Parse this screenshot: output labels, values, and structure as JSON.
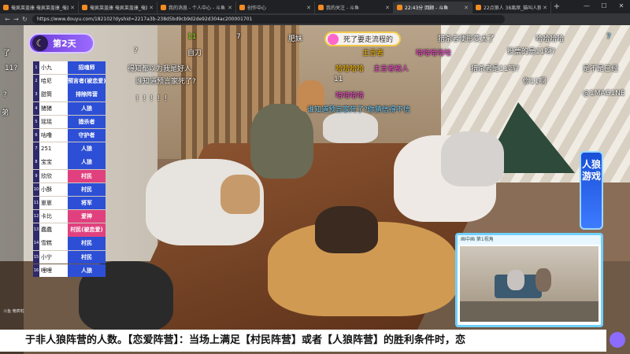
{
  "tabs": [
    {
      "label": "俺疯莱盖康 俺疯莱盖康_俺疯啦"
    },
    {
      "label": "俺疯莱盖康 俺疯莱盖康_俺疯啦"
    },
    {
      "label": "我的消息 - 个人中心 - 斗鱼"
    },
    {
      "label": "创作中心"
    },
    {
      "label": "我的关注 - 斗鱼"
    },
    {
      "label": "22:43分 回顾 - 斗鱼"
    },
    {
      "label": "22点狼人 38离席_猫叫人狼节目"
    }
  ],
  "address": {
    "url": "https://www.douyu.com/182102?dyshid=2217a3b-238d5bd9cb9d2de92d304ac200001701"
  },
  "overlay": {
    "day_label": "第2天",
    "roster": [
      {
        "num": "1",
        "name": "小九",
        "role": "招魂师",
        "color": "blue"
      },
      {
        "num": "2",
        "name": "哈尼",
        "role": "预言者(被恋爱)",
        "color": "blue"
      },
      {
        "num": "3",
        "name": "甜筒",
        "role": "排除阵营",
        "color": "blue"
      },
      {
        "num": "4",
        "name": "猪猪",
        "role": "人狼",
        "color": "blue"
      },
      {
        "num": "5",
        "name": "瑶瑶",
        "role": "猎杀者",
        "color": "blue"
      },
      {
        "num": "6",
        "name": "咕噜",
        "role": "守护者",
        "color": "blue"
      },
      {
        "num": "7",
        "name": "251",
        "role": "人狼",
        "color": "blue"
      },
      {
        "num": "8",
        "name": "宝宝",
        "role": "人狼",
        "color": "blue"
      },
      {
        "num": "9",
        "name": "欣欣",
        "role": "村民",
        "color": "red"
      },
      {
        "num": "10",
        "name": "小酥",
        "role": "村民",
        "color": "blue"
      },
      {
        "num": "11",
        "name": "崽崽",
        "role": "将军",
        "color": "blue"
      },
      {
        "num": "12",
        "name": "卡比",
        "role": "爱神",
        "color": "red"
      },
      {
        "num": "13",
        "name": "蠢蠢",
        "role": "村民(被恋爱)",
        "color": "red"
      },
      {
        "num": "14",
        "name": "雪糕",
        "role": "村民",
        "color": "blue"
      },
      {
        "num": "15",
        "name": "小宁",
        "role": "村民",
        "color": "blue"
      },
      {
        "num": "16",
        "name": "哩哩",
        "role": "人狼",
        "color": "blue"
      }
    ],
    "top_pill": "死了要走流程的",
    "wolf_badge": "人狼游戏",
    "pip_header": "画中画 第1视角",
    "bottom_caption": "于非人狼阵营的人数。【恋爱阵营】：当场上满足【村民阵营】或者【人狼阵营】的胜利条件时，恋",
    "stamp": "斗鱼 俺疯啦"
  },
  "danmaku": [
    {
      "text": "了",
      "cls": ""
    },
    {
      "text": "11?",
      "cls": ""
    },
    {
      "text": "?",
      "cls": ""
    },
    {
      "text": "弟",
      "cls": ""
    },
    {
      "text": "?",
      "cls": ""
    },
    {
      "text": "11",
      "cls": "g"
    },
    {
      "text": "7",
      "cls": ""
    },
    {
      "text": "得知都以为我是好人",
      "cls": ""
    },
    {
      "text": "谁知道预言家死了?",
      "cls": ""
    },
    {
      "text": "！！！！！",
      "cls": ""
    },
    {
      "text": "自刀",
      "cls": ""
    },
    {
      "text": "肥妹",
      "cls": ""
    },
    {
      "text": "猎杀者便形变太了",
      "cls": ""
    },
    {
      "text": "哈哈哈哈",
      "cls": ""
    },
    {
      "text": "7",
      "cls": "b"
    },
    {
      "text": "哈哈哈哈哈",
      "cls": "pk"
    },
    {
      "text": "投票的是11啊?",
      "cls": ""
    },
    {
      "text": "哈哈哈哈",
      "cls": "o"
    },
    {
      "text": "主言者",
      "cls": "o"
    },
    {
      "text": "猎杀者是11吗?",
      "cls": ""
    },
    {
      "text": "是不是已经",
      "cls": ""
    },
    {
      "text": "11",
      "cls": ""
    },
    {
      "text": "你11啊",
      "cls": ""
    },
    {
      "text": "哈哈哈哈",
      "cls": "pk"
    },
    {
      "text": "@1MAG1NE",
      "cls": ""
    },
    {
      "text": "谁知道预言家死了?你猜信得不信",
      "cls": "b"
    },
    {
      "text": "主言者被人",
      "cls": "pk"
    }
  ]
}
